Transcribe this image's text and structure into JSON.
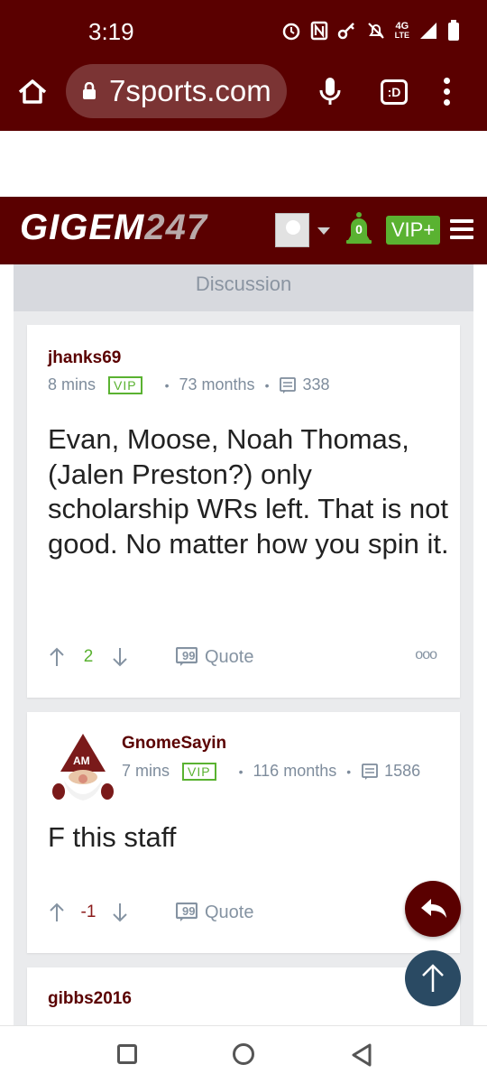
{
  "status_bar": {
    "time": "3:19",
    "network_label": "4G",
    "network_sub": "LTE"
  },
  "browser": {
    "url": "7sports.com",
    "tabs_label": ":D"
  },
  "site_header": {
    "logo_text": "GIGEM",
    "logo_number": "247",
    "notification_count": "0",
    "vip_button": "VIP+"
  },
  "discussion": {
    "title": "Discussion",
    "posts": [
      {
        "username": "jhanks69",
        "time_ago": "8 mins",
        "badge": "VIP",
        "tenure": "73 months",
        "post_count": "338",
        "body": "Evan, Moose, Noah Thomas, (Jalen Preston?) only scholarship WRs left. That is not good. No matter how you spin it.",
        "score": "2",
        "quote_label": "Quote",
        "more_label": "ooo"
      },
      {
        "username": "GnomeSayin",
        "time_ago": "7 mins",
        "badge": "VIP",
        "tenure": "116 months",
        "post_count": "1586",
        "body": "F this staff",
        "score": "-1",
        "quote_label": "Quote"
      },
      {
        "username": "gibbs2016"
      }
    ]
  },
  "colors": {
    "maroon": "#5a0000",
    "vip_green": "#5ab231",
    "negative_red": "#8b1a1a",
    "muted_text": "#7e8c9c"
  }
}
